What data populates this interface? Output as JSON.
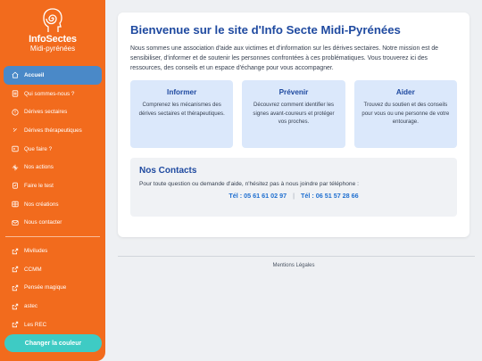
{
  "logo": {
    "title": "InfoSectes",
    "subtitle": "Midi-pyrénées"
  },
  "nav": {
    "main": [
      {
        "label": "Accueil",
        "icon": "home-icon"
      },
      {
        "label": "Qui sommes-nous ?",
        "icon": "document-icon"
      },
      {
        "label": "Dérives sectaires",
        "icon": "alert-icon"
      },
      {
        "label": "Dérives thérapeutiques",
        "icon": "pill-icon"
      },
      {
        "label": "Que faire ?",
        "icon": "help-icon"
      },
      {
        "label": "Nos actions",
        "icon": "sparkle-icon"
      },
      {
        "label": "Faire le test",
        "icon": "clipboard-icon"
      },
      {
        "label": "Nos créations",
        "icon": "gallery-icon"
      },
      {
        "label": "Nous contacter",
        "icon": "mail-icon"
      }
    ],
    "external": [
      {
        "label": "Miviludes",
        "icon": "external-link-icon"
      },
      {
        "label": "CCMM",
        "icon": "external-link-icon"
      },
      {
        "label": "Pensée magique",
        "icon": "external-link-icon"
      },
      {
        "label": "astec",
        "icon": "external-link-icon"
      },
      {
        "label": "Les REC",
        "icon": "external-link-icon"
      }
    ],
    "color_button": "Changer la couleur"
  },
  "main": {
    "title": "Bienvenue sur le site d'Info Secte Midi-Pyrénées",
    "intro": "Nous sommes une association d'aide aux victimes et d'information sur les dérives sectaires. Notre mission est de sensibiliser, d'informer et de soutenir les personnes confrontées à ces problématiques. Vous trouverez ici des ressources, des conseils et un espace d'échange pour vous accompagner.",
    "boxes": [
      {
        "title": "Informer",
        "text": "Comprenez les mécanismes des dérives sectaires et thérapeutiques."
      },
      {
        "title": "Prévenir",
        "text": "Découvrez comment identifier les signes avant-coureurs et protéger vos proches."
      },
      {
        "title": "Aider",
        "text": "Trouvez du soutien et des conseils pour vous ou une personne de votre entourage."
      }
    ],
    "contacts": {
      "title": "Nos Contacts",
      "text": "Pour toute question ou demande d'aide, n'hésitez pas à nous joindre par téléphone :",
      "phone1": "Tél : 05 61 61 02 97",
      "separator": "|",
      "phone2": "Tél : 06 51 57 28 66"
    }
  },
  "footer": {
    "label": "Mentions Légales"
  },
  "colors": {
    "sidebar": "#f26b1d",
    "active": "#4a89c8",
    "button": "#3ecbc4",
    "title": "#1f4aa0",
    "box": "#dbe8fb",
    "phone": "#1f6fd0"
  }
}
